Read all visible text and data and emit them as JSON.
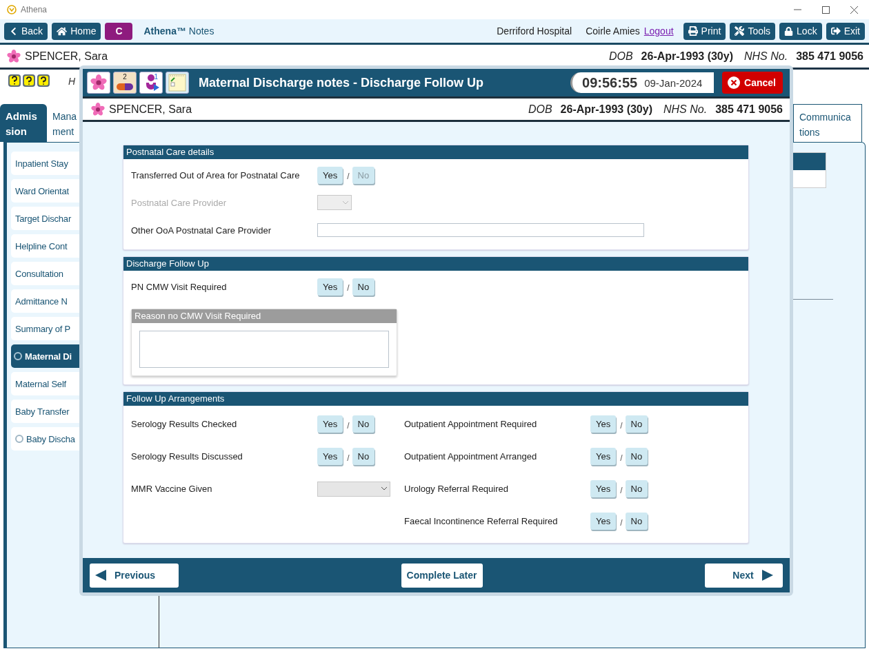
{
  "window": {
    "title": "Athena"
  },
  "toolbar": {
    "left_buttons": [
      {
        "kind": "back",
        "label": "Back"
      },
      {
        "kind": "home",
        "label": "Home"
      },
      {
        "kind": "letter",
        "label": "C"
      }
    ],
    "app_name": "**Athena™** Notes",
    "hospital": "Derriford Hospital",
    "user": "Coirle Amies",
    "logout": "Logout",
    "right_buttons": [
      {
        "kind": "print",
        "label": "Print"
      },
      {
        "kind": "tools",
        "label": "Tools"
      },
      {
        "kind": "lock",
        "label": "Lock"
      },
      {
        "kind": "exit",
        "label": "Exit"
      }
    ]
  },
  "patient": {
    "name": "SPENCER, Sara",
    "dob_label": "DOB",
    "dob": "26-Apr-1993 (30y)",
    "nhs_label": "NHS No.",
    "nhs": "385 471 9056"
  },
  "subtitle": "H",
  "tabs": [
    {
      "label": "Admis sion",
      "selected": true
    },
    {
      "label": "Mana ment",
      "selected": false
    },
    {
      "label": "Communica tions",
      "selected": false
    }
  ],
  "sidebar": {
    "items": [
      {
        "label": "Inpatient Stay",
        "selected": false,
        "status_ring": false
      },
      {
        "label": "Ward Orientat",
        "selected": false,
        "status_ring": false
      },
      {
        "label": "Target Dischar",
        "selected": false,
        "status_ring": false
      },
      {
        "label": "Helpline Cont",
        "selected": false,
        "status_ring": false
      },
      {
        "label": "Consultation",
        "selected": false,
        "status_ring": false
      },
      {
        "label": "Admittance N",
        "selected": false,
        "status_ring": false
      },
      {
        "label": "Summary of P",
        "selected": false,
        "status_ring": false
      },
      {
        "label": "Maternal Di",
        "selected": true,
        "status_ring": true
      },
      {
        "label": "Maternal Self",
        "selected": false,
        "status_ring": false
      },
      {
        "label": "Baby Transfer",
        "selected": false,
        "status_ring": false
      },
      {
        "label": "Baby Discha",
        "selected": false,
        "status_ring": true
      }
    ]
  },
  "dialog": {
    "header_icons": [
      {
        "kind": "flower"
      },
      {
        "kind": "medication",
        "count": "2"
      },
      {
        "kind": "person",
        "count": "1"
      },
      {
        "kind": "notes"
      }
    ],
    "title": "Maternal Discharge notes - Discharge Follow Up",
    "time": "09:56:55",
    "date": "09-Jan-2024",
    "cancel": "Cancel",
    "patient": {
      "name": "SPENCER, Sara",
      "dob_label": "DOB",
      "dob": "26-Apr-1993 (30y)",
      "nhs_label": "NHS No.",
      "nhs": "385 471 9056"
    },
    "sections": [
      {
        "title": "Postnatal Care details",
        "columns": [
          [
            {
              "kind": "yesno",
              "label": "Transferred Out of Area for Postnatal Care",
              "separator": "/",
              "options": [
                {
                  "label": "Yes",
                  "disabled": false
                },
                {
                  "label": "No",
                  "disabled": true
                }
              ]
            },
            {
              "kind": "select",
              "label": "Postnatal Care Provider",
              "disabled": true
            },
            {
              "kind": "text",
              "label": "Other OoA Postnatal Care Provider"
            }
          ]
        ]
      },
      {
        "title": "Discharge Follow Up",
        "columns": [
          [
            {
              "kind": "yesno",
              "label": "PN CMW Visit Required",
              "separator": "/",
              "options": [
                {
                  "label": "Yes",
                  "disabled": false
                },
                {
                  "label": "No",
                  "disabled": false
                }
              ]
            },
            {
              "kind": "group",
              "title": "Reason no CMW Visit Required",
              "disabled": true
            }
          ]
        ]
      },
      {
        "title": "Follow Up Arrangements",
        "columns": [
          [
            {
              "kind": "yesno",
              "label": "Serology Results Checked",
              "separator": "/",
              "options": [
                {
                  "label": "Yes",
                  "disabled": false
                },
                {
                  "label": "No",
                  "disabled": false
                }
              ]
            },
            {
              "kind": "yesno",
              "label": "Serology Results Discussed",
              "separator": "/",
              "options": [
                {
                  "label": "Yes",
                  "disabled": false
                },
                {
                  "label": "No",
                  "disabled": false
                }
              ]
            },
            {
              "kind": "select",
              "label": "MMR Vaccine Given",
              "disabled": false
            }
          ],
          [
            {
              "kind": "yesno",
              "label": "Outpatient Appointment Required",
              "separator": "/",
              "options": [
                {
                  "label": "Yes",
                  "disabled": false
                },
                {
                  "label": "No",
                  "disabled": false
                }
              ]
            },
            {
              "kind": "yesno",
              "label": "Outpatient Appointment Arranged",
              "separator": "/",
              "options": [
                {
                  "label": "Yes",
                  "disabled": false
                },
                {
                  "label": "No",
                  "disabled": false
                }
              ]
            },
            {
              "kind": "yesno",
              "label": "Urology Referral Required",
              "separator": "/",
              "options": [
                {
                  "label": "Yes",
                  "disabled": false
                },
                {
                  "label": "No",
                  "disabled": false
                }
              ]
            },
            {
              "kind": "yesno",
              "label": "Faecal Incontinence Referral Required",
              "separator": "/",
              "options": [
                {
                  "label": "Yes",
                  "disabled": false
                },
                {
                  "label": "No",
                  "disabled": false
                }
              ]
            }
          ]
        ]
      }
    ],
    "footer": {
      "previous": "Previous",
      "complete_later": "Complete Later",
      "next": "Next"
    }
  }
}
